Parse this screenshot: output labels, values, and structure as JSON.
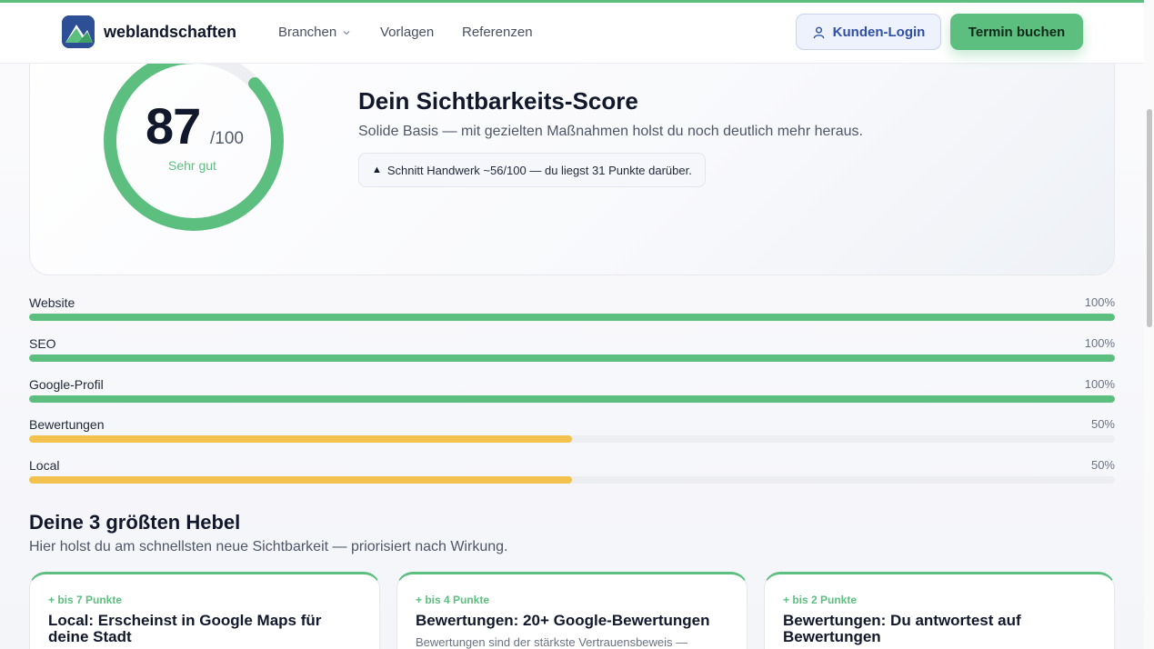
{
  "colors": {
    "accent_green": "#5cbf7f",
    "accent_yellow": "#f2c14e",
    "login_blue": "#2f4fa6"
  },
  "header": {
    "brand": "weblandschaften",
    "nav": [
      {
        "label": "Branchen",
        "has_dropdown": true
      },
      {
        "label": "Vorlagen",
        "has_dropdown": false
      },
      {
        "label": "Referenzen",
        "has_dropdown": false
      }
    ],
    "login_label": "Kunden-Login",
    "login_icon": "user-icon",
    "book_label": "Termin buchen"
  },
  "score": {
    "value": "87",
    "max": "/100",
    "rating": "Sehr gut",
    "fraction": 0.87,
    "title": "Dein Sichtbarkeits-Score",
    "description": "Solide Basis — mit gezielten Maßnahmen holst du noch deutlich mehr heraus.",
    "compare_icon": "triangle-up-icon",
    "compare": "Schnitt Handwerk ~56/100 — du liegst 31 Punkte darüber."
  },
  "bars": [
    {
      "label": "Website",
      "pct": "100%",
      "value": 100,
      "color": "#5cbf7f"
    },
    {
      "label": "SEO",
      "pct": "100%",
      "value": 100,
      "color": "#5cbf7f"
    },
    {
      "label": "Google-Profil",
      "pct": "100%",
      "value": 100,
      "color": "#5cbf7f"
    },
    {
      "label": "Bewertungen",
      "pct": "50%",
      "value": 50,
      "color": "#f2c14e"
    },
    {
      "label": "Local",
      "pct": "50%",
      "value": 50,
      "color": "#f2c14e"
    }
  ],
  "levers": {
    "title": "Deine 3 größten Hebel",
    "subtitle": "Hier holst du am schnellsten neue Sichtbarkeit — priorisiert nach Wirkung.",
    "cards": [
      {
        "badge": "+ bis 7 Punkte",
        "title": "Local: Erscheinst in Google Maps für deine Stadt",
        "body": ""
      },
      {
        "badge": "+ bis 4 Punkte",
        "title": "Bewertungen: 20+ Google-Bewertungen",
        "body": "Bewertungen sind der stärkste Vertrauensbeweis —"
      },
      {
        "badge": "+ bis 2 Punkte",
        "title": "Bewertungen: Du antwortest auf Bewertungen",
        "body": ""
      }
    ]
  }
}
